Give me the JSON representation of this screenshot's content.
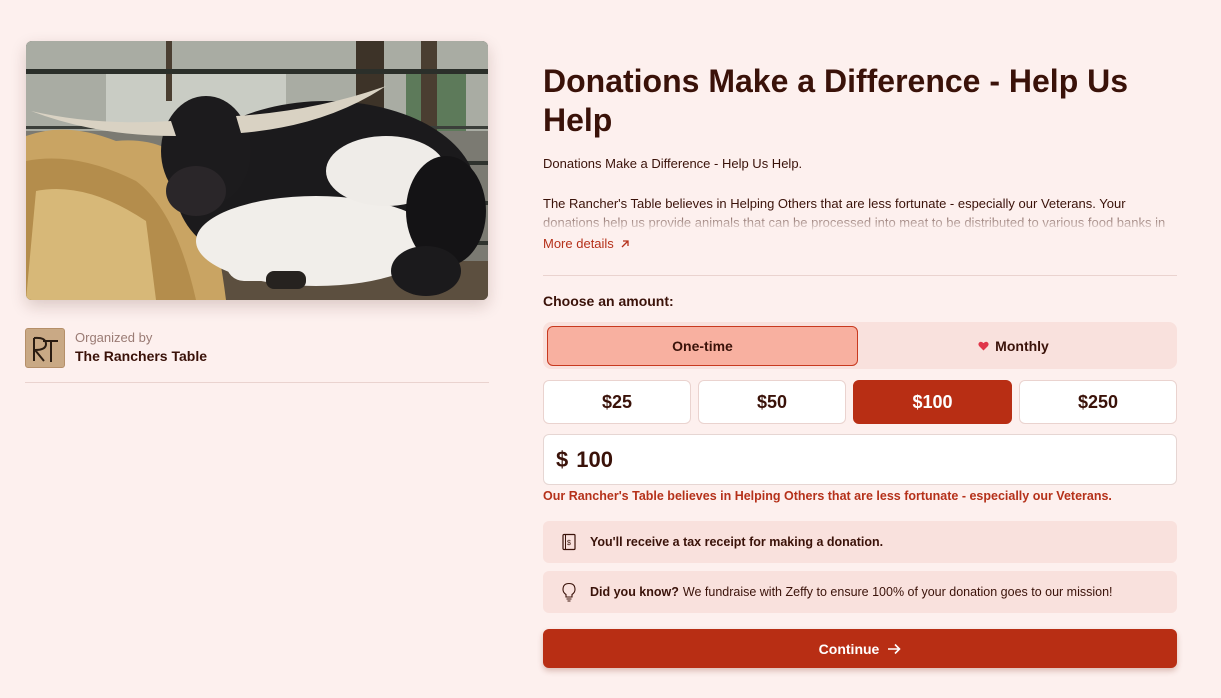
{
  "hero": {
    "image_alt": "Longhorn steer lying in hay"
  },
  "organizer": {
    "label": "Organized by",
    "name": "The Ranchers Table",
    "logo_text": "RT"
  },
  "campaign": {
    "title": "Donations Make a Difference - Help Us Help",
    "subtitle": "Donations Make a Difference - Help Us Help.",
    "description": "The Rancher's Table believes in Helping Others that are less fortunate - especially our Veterans. Your donations help us provide animals that can be processed into meat to be distributed to various food banks in",
    "more_details": "More details"
  },
  "form": {
    "choose_label": "Choose an amount:",
    "frequency": {
      "one_time": "One-time",
      "monthly": "Monthly",
      "selected": "One-time"
    },
    "amounts": [
      "$25",
      "$50",
      "$100",
      "$250"
    ],
    "selected_amount": "$100",
    "currency_symbol": "$",
    "amount_value": "100",
    "note": "Our Rancher's Table believes in Helping Others that are less fortunate - especially our Veterans.",
    "tax_receipt": "You'll receive a tax receipt for making a donation.",
    "did_you_know_label": "Did you know?",
    "did_you_know_text": "We fundraise with Zeffy to ensure 100% of your donation goes to our mission!",
    "continue_label": "Continue"
  },
  "colors": {
    "background": "#fdf0ee",
    "accent": "#b82e14",
    "accent_light": "#f8b0a0",
    "panel": "#f9e1dd",
    "text": "#3a1209"
  },
  "icons": {
    "more": "arrow-up-right-icon",
    "monthly": "heart-icon",
    "receipt": "receipt-icon",
    "tip": "lightbulb-icon",
    "continue": "arrow-right-icon"
  }
}
